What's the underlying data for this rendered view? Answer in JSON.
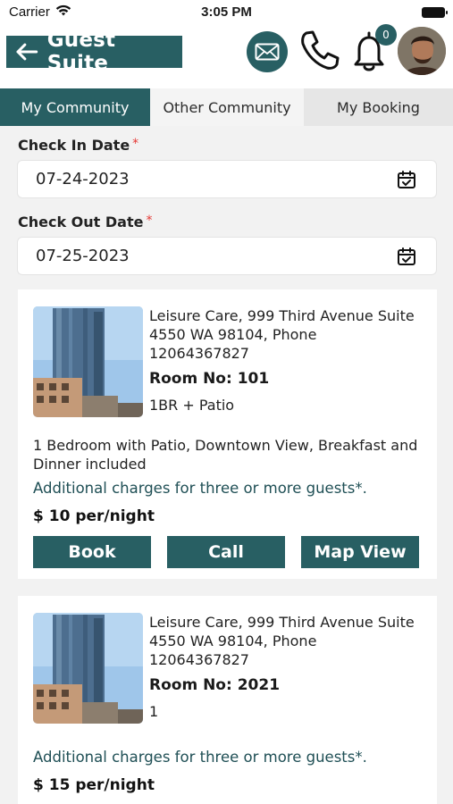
{
  "status_bar": {
    "carrier": "Carrier",
    "time": "3:05 PM"
  },
  "header": {
    "title": "Guest Suite",
    "notification_count": "0"
  },
  "tabs": [
    {
      "label": "My Community",
      "active": true
    },
    {
      "label": "Other Community",
      "active": false
    },
    {
      "label": "My Booking",
      "active": false
    }
  ],
  "form": {
    "check_in_label": "Check In Date",
    "check_in_value": "07-24-2023",
    "check_out_label": "Check Out Date",
    "check_out_value": "07-25-2023",
    "required_mark": "*"
  },
  "rooms": [
    {
      "address": "Leisure Care, 999 Third Avenue Suite 4550 WA 98104, Phone 12064367827",
      "room_no": "Room No: 101",
      "room_type": "1BR + Patio",
      "description": "1 Bedroom with Patio, Downtown View, Breakfast and Dinner included",
      "charges_note": "Additional charges for three or more guests*.",
      "price": "$ 10 per/night"
    },
    {
      "address": "Leisure Care, 999 Third Avenue Suite 4550 WA 98104, Phone 12064367827",
      "room_no": "Room No: 2021",
      "room_type": "1",
      "description": "",
      "charges_note": "Additional charges for three or more guests*.",
      "price": "$ 15 per/night"
    }
  ],
  "actions": {
    "book": "Book",
    "call": "Call",
    "map": "Map View"
  },
  "colors": {
    "accent": "#285f63",
    "required": "#e53935"
  },
  "icons": [
    "wifi-icon",
    "battery-icon",
    "back-arrow-icon",
    "mail-icon",
    "phone-icon",
    "bell-icon",
    "calendar-icon"
  ]
}
